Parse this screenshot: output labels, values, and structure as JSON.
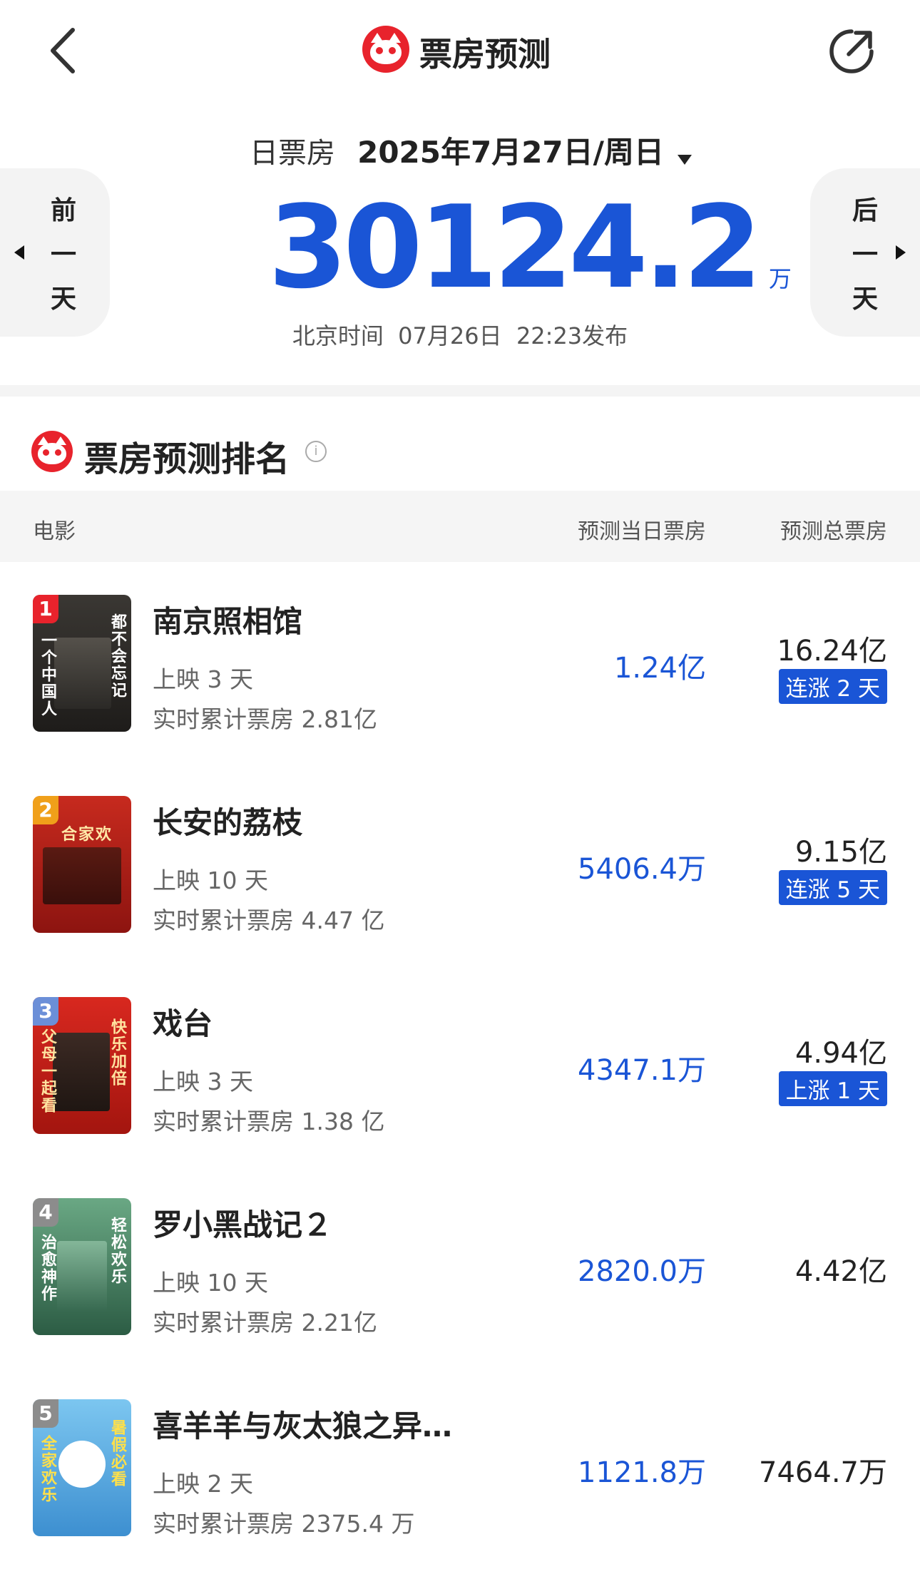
{
  "header": {
    "title": "票房预测",
    "back_icon": "chevron-left-icon",
    "share_icon": "share-icon"
  },
  "date_selector": {
    "label": "日票房",
    "date": "2025年7月27日/周日",
    "prev_label": [
      "前",
      "一",
      "天"
    ],
    "next_label": [
      "后",
      "一",
      "天"
    ]
  },
  "summary": {
    "value": "30124.2",
    "unit": "万",
    "published": "北京时间  07月26日  22:23发布"
  },
  "ranking": {
    "title": "票房预测排名",
    "columns": [
      "电影",
      "预测当日票房",
      "预测总票房"
    ],
    "movies": [
      {
        "rank": "1",
        "title": "南京照相馆",
        "days": "上映 3 天",
        "cumulative": "实时累计票房 2.81亿",
        "day_forecast": "1.24亿",
        "total_forecast": "16.24亿",
        "trend": "连涨 2 天",
        "poster_text": "都不会忘记",
        "poster_text_left": "一个中国人",
        "poster_color": "#2d2b28",
        "rank_color": "#e8232c"
      },
      {
        "rank": "2",
        "title": "长安的荔枝",
        "days": "上映 10 天",
        "cumulative": "实时累计票房 4.47 亿",
        "day_forecast": "5406.4万",
        "total_forecast": "9.15亿",
        "trend": "连涨 5 天",
        "poster_text": "合家欢",
        "poster_color": "#b31f1a",
        "rank_color": "#f0a01a"
      },
      {
        "rank": "3",
        "title": "戏台",
        "days": "上映 3 天",
        "cumulative": "实时累计票房 1.38 亿",
        "day_forecast": "4347.1万",
        "total_forecast": "4.94亿",
        "trend": "上涨 1 天",
        "poster_text": "快乐加倍",
        "poster_text_left": "父母一起看",
        "poster_color": "#c8201c",
        "rank_color": "#6b8fd8"
      },
      {
        "rank": "4",
        "title": "罗小黑战记２",
        "days": "上映 10 天",
        "cumulative": "实时累计票房 2.21亿",
        "day_forecast": "2820.0万",
        "total_forecast": "4.42亿",
        "trend": "",
        "poster_text": "轻松欢乐",
        "poster_text_left": "治愈神作",
        "poster_color": "#3f7d5a",
        "rank_color": "#8c8c8c"
      },
      {
        "rank": "5",
        "title": "喜羊羊与灰太狼之异…",
        "days": "上映 2 天",
        "cumulative": "实时累计票房 2375.4 万",
        "day_forecast": "1121.8万",
        "total_forecast": "7464.7万",
        "trend": "",
        "poster_text": "暑假必看",
        "poster_text_left": "全家欢乐",
        "poster_color": "#57a9e0",
        "rank_color": "#8c8c8c"
      }
    ]
  }
}
